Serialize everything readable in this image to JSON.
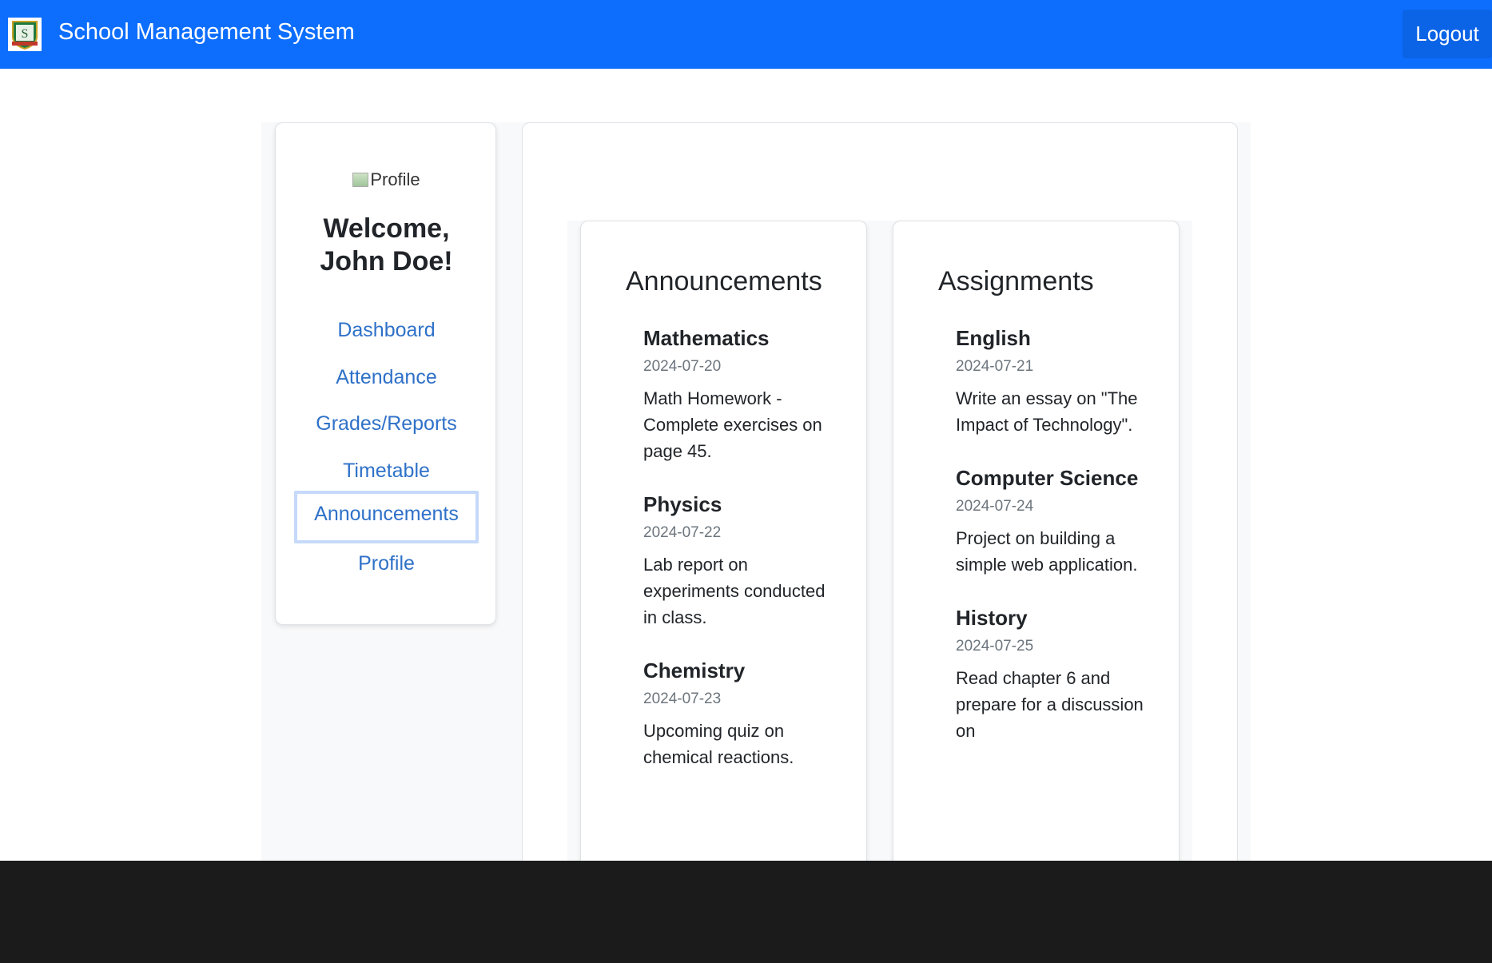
{
  "header": {
    "logo_letter": "S",
    "title": "School Management System",
    "logout_label": "Logout"
  },
  "sidebar": {
    "profile_alt": "Profile",
    "welcome_line1": "Welcome,",
    "welcome_line2": "John Doe!",
    "items": [
      {
        "label": "Dashboard"
      },
      {
        "label": "Attendance"
      },
      {
        "label": "Grades/Reports"
      },
      {
        "label": "Timetable"
      },
      {
        "label": "Announcements",
        "active": true
      },
      {
        "label": "Profile"
      }
    ]
  },
  "announcements": {
    "heading": "Announcements",
    "items": [
      {
        "title": "Mathematics",
        "date": "2024-07-20",
        "desc": "Math Homework - Complete exercises on page 45."
      },
      {
        "title": "Physics",
        "date": "2024-07-22",
        "desc": "Lab report on experiments conducted in class."
      },
      {
        "title": "Chemistry",
        "date": "2024-07-23",
        "desc": "Upcoming quiz on chemical reactions."
      }
    ]
  },
  "assignments": {
    "heading": "Assignments",
    "items": [
      {
        "title": "English",
        "date": "2024-07-21",
        "desc": "Write an essay on \"The Impact of Technology\"."
      },
      {
        "title": "Computer Science",
        "date": "2024-07-24",
        "desc": "Project on building a simple web application."
      },
      {
        "title": "History",
        "date": "2024-07-25",
        "desc": "Read chapter 6 and prepare for a discussion on"
      }
    ]
  },
  "colors": {
    "navbar": "#0d6efd",
    "link": "#2f71c8",
    "active_border": "#c6d9fa",
    "bottom_bar": "#1b1b1b"
  }
}
